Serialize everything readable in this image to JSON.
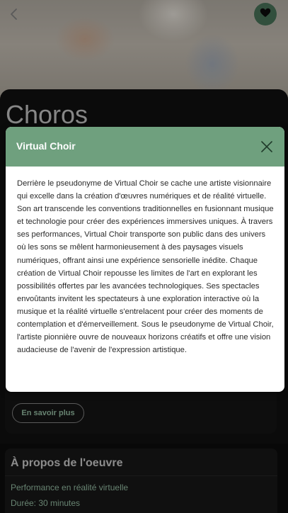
{
  "hero": {
    "back_icon": "chevron-left-icon",
    "favorite_icon": "heart-icon",
    "accent_color": "#4d7a5f"
  },
  "page": {
    "title": "Choros",
    "more_button_label": "En savoir plus"
  },
  "about": {
    "heading": "À propos de l'oeuvre",
    "lines": [
      "Performance en réalité virtuelle",
      "Durée: 30 minutes"
    ]
  },
  "modal": {
    "title": "Virtual Choir",
    "header_color": "#6fa07e",
    "close_icon": "close-icon",
    "body": "Derrière le pseudonyme de Virtual Choir se cache une artiste visionnaire qui excelle dans la création d'œuvres numériques et de réalité virtuelle. Son art transcende les conventions traditionnelles en fusionnant musique et technologie pour créer des expériences immersives uniques. À travers ses performances, Virtual Choir transporte son public dans des univers où les sons se mêlent harmonieusement à des paysages visuels numériques, offrant ainsi une expérience sensorielle inédite. Chaque création de Virtual Choir repousse les limites de l'art en explorant les possibilités offertes par les avancées technologiques. Ses spectacles envoûtants invitent les spectateurs à une exploration interactive où la musique et la réalité virtuelle s'entrelacent pour créer des moments de contemplation et d'émerveillement. Sous le pseudonyme de Virtual Choir, l'artiste pionnière ouvre de nouveaux horizons créatifs et offre une vision audacieuse de l'avenir de l'expression artistique."
  }
}
